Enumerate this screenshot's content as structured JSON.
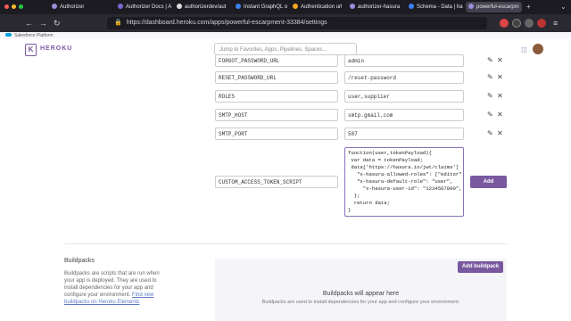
{
  "browser": {
    "tabs": [
      {
        "label": "Authorizer"
      },
      {
        "label": "Authorizer Docs | A"
      },
      {
        "label": "authorizerdev/aut"
      },
      {
        "label": "Instant GraphQL o"
      },
      {
        "label": "Authentication url"
      },
      {
        "label": "authorizer-hasura"
      },
      {
        "label": "Schema - Data | ha"
      },
      {
        "label": "powerful-escarpm"
      }
    ],
    "url": "https://dashboard.heroku.com/apps/powerful-escarpment-33384/settings"
  },
  "salesforce": {
    "label": "Salesforce Platform"
  },
  "header": {
    "brand": "HEROKU",
    "logo_letter": "K",
    "search_placeholder": "Jump to Favorites, Apps, Pipelines, Spaces..."
  },
  "config_vars": [
    {
      "key": "FORGOT_PASSWORD_URL",
      "value": "admin"
    },
    {
      "key": "RESET_PASSWORD_URL",
      "value": "/reset-password"
    },
    {
      "key": "ROLES",
      "value": "user,supplier"
    },
    {
      "key": "SMTP_HOST",
      "value": "smtp.gmail.com"
    },
    {
      "key": "SMTP_PORT",
      "value": "587"
    }
  ],
  "new_var": {
    "key": "CUSTOM_ACCESS_TOKEN_SCRIPT",
    "code": [
      "function(user,tokenPayload){",
      " var data = tokenPayload;",
      " data['https://hasura.io/jwt/claims']",
      "   \"x-hasura-allowed-roles\": [\"editor\"",
      "   \"x-hasura-default-role\": \"user\",",
      "     \"x-hasura-user-id\": \"1234567890\",",
      "  };",
      "  return data;",
      "}"
    ],
    "add_label": "Add"
  },
  "buildpacks": {
    "title": "Buildpacks",
    "description": "Buildpacks are scripts that are run when your app is deployed. They are used to install dependencies for your app and configure your environment.",
    "link_text": "Find new buildpacks on Heroku Elements",
    "add_label": "Add buildpack",
    "empty_title": "Buildpacks will appear here",
    "empty_desc": "Buildpacks are used to install dependencies for your app and configure your environment."
  }
}
